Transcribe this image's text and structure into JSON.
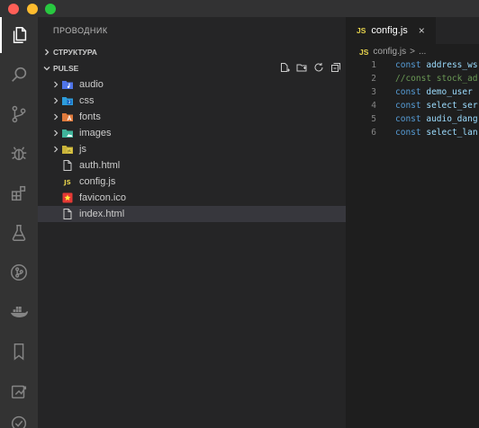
{
  "window": {
    "controls": [
      "close",
      "minimize",
      "zoom"
    ]
  },
  "activity_bar": {
    "items": [
      {
        "icon": "files-icon",
        "active": true
      },
      {
        "icon": "search-icon",
        "active": false
      },
      {
        "icon": "source-control-icon",
        "active": false
      },
      {
        "icon": "debug-icon",
        "active": false
      },
      {
        "icon": "extensions-icon",
        "active": false
      },
      {
        "icon": "testing-flask-icon",
        "active": false
      },
      {
        "icon": "git-graph-icon",
        "active": false
      },
      {
        "icon": "docker-icon",
        "active": false
      },
      {
        "icon": "bookmark-icon",
        "active": false
      },
      {
        "icon": "remote-explorer-icon",
        "active": false
      },
      {
        "icon": "check-circle-icon",
        "active": false
      }
    ]
  },
  "sidebar": {
    "title": "ПРОВОДНИК",
    "outline_section": "СТРУКТУРА",
    "workspace_section": "PULSE",
    "actions": [
      "new-file-icon",
      "new-folder-icon",
      "refresh-icon",
      "collapse-all-icon"
    ],
    "tree": [
      {
        "label": "audio",
        "type": "folder",
        "icon": "audio-folder-icon",
        "color": "#4f74e8"
      },
      {
        "label": "css",
        "type": "folder",
        "icon": "css-folder-icon",
        "color": "#2d9cdb"
      },
      {
        "label": "fonts",
        "type": "folder",
        "icon": "fonts-folder-icon",
        "color": "#e07a3c"
      },
      {
        "label": "images",
        "type": "folder",
        "icon": "images-folder-icon",
        "color": "#3fb49b"
      },
      {
        "label": "js",
        "type": "folder",
        "icon": "js-folder-icon",
        "color": "#e8d44d"
      },
      {
        "label": "auth.html",
        "type": "file",
        "icon": "html-file-icon",
        "color": "#cccccc"
      },
      {
        "label": "config.js",
        "type": "file",
        "icon": "js-file-icon",
        "color": "#e8d44d"
      },
      {
        "label": "favicon.ico",
        "type": "file",
        "icon": "favicon-file-icon",
        "color": "#e53935"
      },
      {
        "label": "index.html",
        "type": "file",
        "icon": "html-file-icon",
        "color": "#cccccc",
        "selected": true
      }
    ]
  },
  "editor": {
    "tab": {
      "badge": "JS",
      "label": "config.js",
      "close": "×"
    },
    "breadcrumb": {
      "badge": "JS",
      "file": "config.js",
      "separator": ">",
      "more": "..."
    },
    "lines": [
      {
        "num": "1",
        "keyword": "const",
        "ident": "address_ws"
      },
      {
        "num": "2",
        "comment": "//const stock_ad"
      },
      {
        "num": "3",
        "keyword": "const",
        "ident": "demo_user"
      },
      {
        "num": "4",
        "keyword": "const",
        "ident": "select_ser"
      },
      {
        "num": "5",
        "keyword": "const",
        "ident": "audio_dang"
      },
      {
        "num": "6",
        "keyword": "const",
        "ident": "select_lan"
      }
    ]
  },
  "colors": {
    "activity_bar": "#333333",
    "sidebar": "#252526",
    "editor": "#1e1e1e",
    "selected_row": "#37373d",
    "keyword": "#569cd6",
    "identifier": "#9cdcfe",
    "comment": "#6a9955"
  }
}
